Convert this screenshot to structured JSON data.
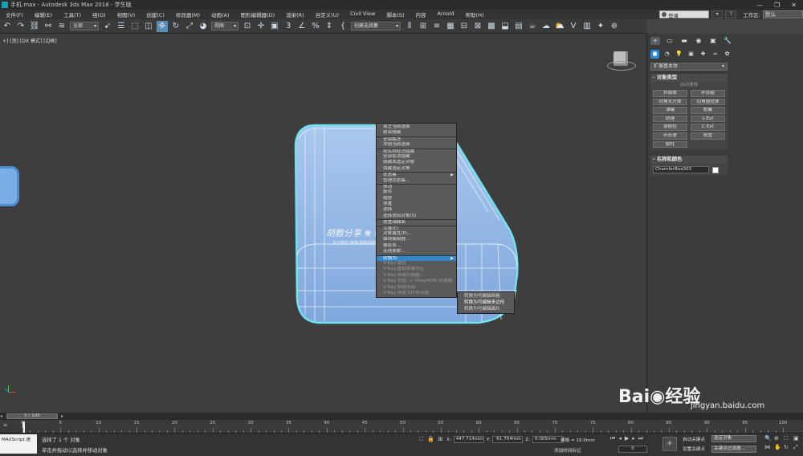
{
  "window": {
    "title": "手机.max - Autodesk 3ds Max 2018 - 学生版",
    "controls": [
      "—",
      "❐",
      "✕"
    ]
  },
  "menu": {
    "items": [
      "文件(F)",
      "编辑(E)",
      "工具(T)",
      "组(G)",
      "视图(V)",
      "创建(C)",
      "修改器(M)",
      "动画(A)",
      "图形编辑器(D)",
      "渲染(R)",
      "自定义(U)",
      "Civil View",
      "脚本(S)",
      "内容",
      "Arnold",
      "帮助(H)"
    ],
    "login": "登录",
    "workspace_label": "工作区:",
    "workspace_value": "默认"
  },
  "toolbar": {
    "filter_select": "全部",
    "view_select": "视图",
    "named_sel": "创建选择集"
  },
  "viewport": {
    "label": "+] [顶] [DX 模式] [边框]"
  },
  "context_menu": {
    "items": [
      {
        "label": "孤立当前选择",
        "sep": false
      },
      {
        "label": "结束隔离",
        "sep": false
      },
      {
        "label": "全部解冻",
        "sep": true
      },
      {
        "label": "冻结当前选择",
        "sep": false
      },
      {
        "label": "按名称取消隐藏",
        "sep": true
      },
      {
        "label": "全部取消隐藏",
        "sep": false
      },
      {
        "label": "隐藏未选定对象",
        "sep": false
      },
      {
        "label": "隐藏选定对象",
        "sep": false
      },
      {
        "label": "状态集",
        "sep": true,
        "arrow": true
      },
      {
        "label": "管理状态集...",
        "sep": false
      },
      {
        "label": "移动",
        "sep": true
      },
      {
        "label": "旋转",
        "sep": false
      },
      {
        "label": "缩放",
        "sep": false
      },
      {
        "label": "放置",
        "sep": false
      },
      {
        "label": "选择",
        "sep": false
      },
      {
        "label": "选择类似对象(S)",
        "sep": false
      },
      {
        "label": "放置轴曲面",
        "sep": true
      },
      {
        "label": "克隆(C)",
        "sep": true
      },
      {
        "label": "对象属性(P)...",
        "sep": false
      },
      {
        "label": "曲线编辑器...",
        "sep": false
      },
      {
        "label": "摄影表...",
        "sep": false
      },
      {
        "label": "连线参数...",
        "sep": false
      },
      {
        "label": "转换为:",
        "sep": true,
        "arrow": true,
        "highlight": true
      },
      {
        "label": "V-Ray 属性",
        "sep": false
      },
      {
        "label": "V-Ray 虚拟帧缓冲区",
        "sep": false
      },
      {
        "label": "V-Ray 场景转换器",
        "sep": false
      },
      {
        "label": "V-Ray 位图 -> VRayHDRI 转换器",
        "sep": false
      },
      {
        "label": "V-Ray 网格导出",
        "sep": false
      },
      {
        "label": "V-Ray 场景文件导出器",
        "sep": false
      }
    ],
    "submenu": [
      "转换为可编辑网格",
      "转换为可编辑多边形",
      "转换为可编辑面片"
    ]
  },
  "watermark": {
    "line1": "胡敷分享 ❀ ◎ LeXuan ✕",
    "line2": "关注微信·微博·获取视频教程 LeXuan"
  },
  "command_panel": {
    "tabs": [
      "+",
      "▭",
      "▬",
      "◉",
      "▣",
      "🔧"
    ],
    "category": "扩展基本体",
    "object_type": {
      "title": "对象类型",
      "autogrid": "自动栅格",
      "buttons": [
        "异面体",
        "环形结",
        "切角长方体",
        "切角圆柱体",
        "油罐",
        "胶囊",
        "纺锤",
        "L-Ext",
        "球棱柱",
        "C-Ext",
        "环形波",
        "软管",
        "棱柱"
      ]
    },
    "name_color": {
      "title": "名称和颜色",
      "name": "ChamferBox003"
    }
  },
  "time": {
    "slider": "0 / 100",
    "ticks": [
      "0",
      "5",
      "10",
      "15",
      "20",
      "25",
      "30",
      "35",
      "40",
      "45",
      "50",
      "55",
      "60",
      "65",
      "70",
      "75",
      "80",
      "85",
      "90",
      "95",
      "100"
    ]
  },
  "status": {
    "maxscript": "MAXScript 迷",
    "line1": "选择了 1 个 对象",
    "line2": "单击并拖动以选择并移动对象",
    "x": "447.714mm",
    "y": "-61.704mm",
    "z": "0.005mm",
    "grid": "栅格 = 10.0mm",
    "add_time": "添加时间标记",
    "frame": "0",
    "autokey": "自动关键点",
    "keyset": "选定对象",
    "setkey": "设置关键点",
    "filter": "关键点过滤器..."
  },
  "brand": {
    "logo": "Bai◉经验",
    "url": "jingyan.baidu.com"
  }
}
